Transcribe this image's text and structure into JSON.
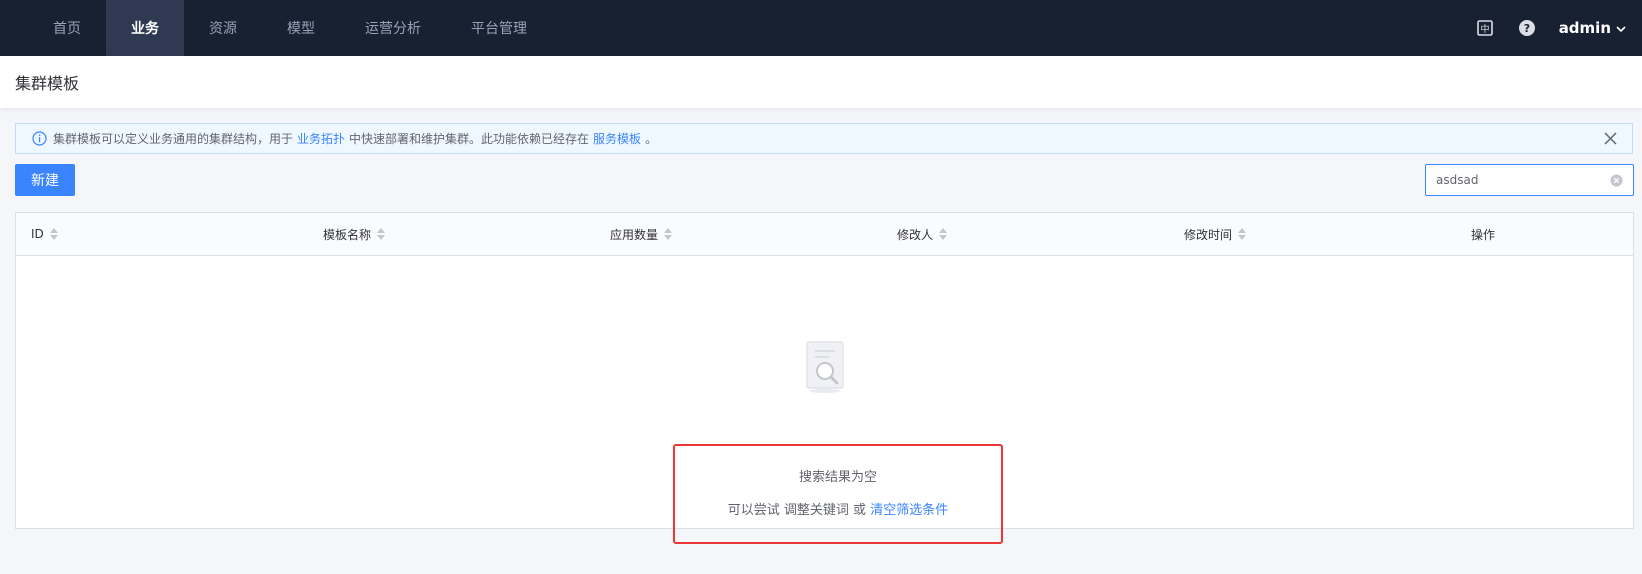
{
  "nav": {
    "items": [
      {
        "label": "首页",
        "active": false
      },
      {
        "label": "业务",
        "active": true
      },
      {
        "label": "资源",
        "active": false
      },
      {
        "label": "模型",
        "active": false
      },
      {
        "label": "运营分析",
        "active": false
      },
      {
        "label": "平台管理",
        "active": false
      }
    ],
    "user": "admin",
    "icons": [
      "language-icon",
      "help-icon",
      "chevron-down-icon"
    ]
  },
  "page": {
    "title": "集群模板"
  },
  "alert": {
    "text_1": "集群模板可以定义业务通用的集群结构，用于",
    "link_1": "业务拓扑",
    "text_2": "中快速部署和维护集群。此功能依赖已经存在",
    "link_2": "服务模板",
    "text_3": "。"
  },
  "toolbar": {
    "create_label": "新建"
  },
  "search": {
    "value": "asdsad",
    "placeholder": ""
  },
  "table": {
    "columns": [
      "ID",
      "模板名称",
      "应用数量",
      "修改人",
      "修改时间",
      "操作"
    ]
  },
  "empty": {
    "title": "搜索结果为空",
    "tip_prefix": "可以尝试 调整关键词 或",
    "tip_link": "清空筛选条件"
  },
  "colors": {
    "nav_bg": "#182132",
    "primary": "#3a84ff",
    "highlight": "#ea3636"
  }
}
